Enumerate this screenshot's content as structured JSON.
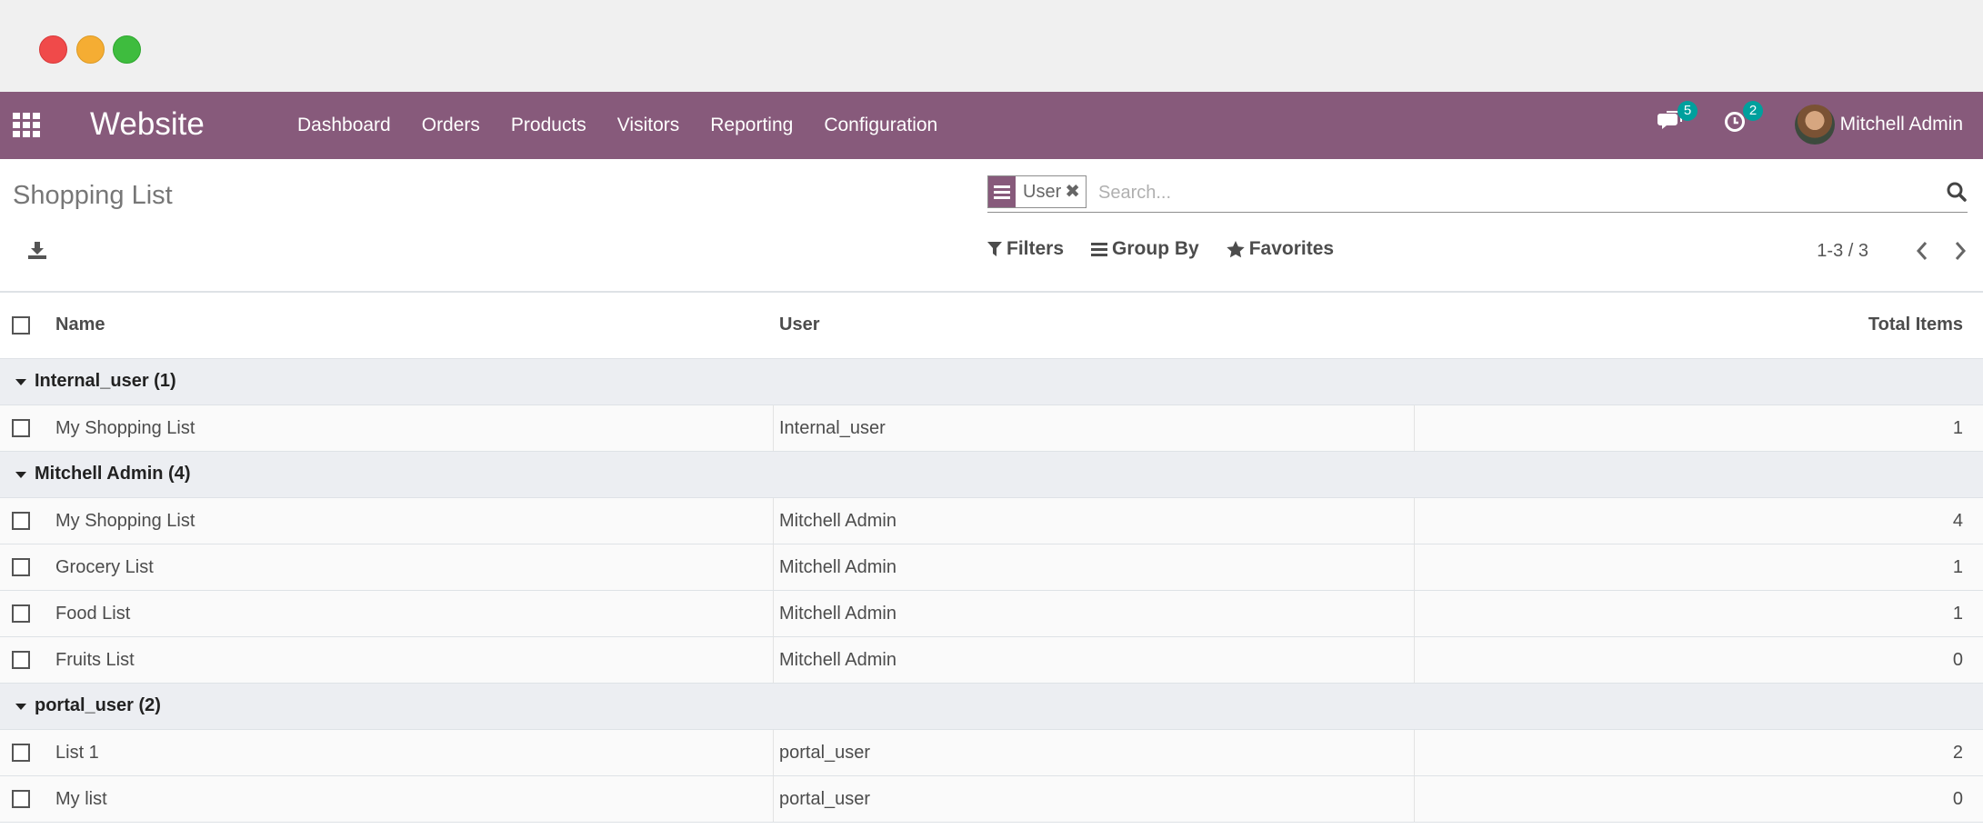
{
  "navbar": {
    "brand": "Website",
    "menu": [
      "Dashboard",
      "Orders",
      "Products",
      "Visitors",
      "Reporting",
      "Configuration"
    ],
    "messages_count": "5",
    "activities_count": "2",
    "user_name": "Mitchell Admin"
  },
  "control_panel": {
    "title": "Shopping List",
    "facet_label": "User",
    "search_placeholder": "Search...",
    "filters_label": "Filters",
    "group_by_label": "Group By",
    "favorites_label": "Favorites",
    "pager": "1-3 / 3"
  },
  "list": {
    "columns": {
      "name": "Name",
      "user": "User",
      "total": "Total Items"
    },
    "groups": [
      {
        "label": "Internal_user (1)",
        "rows": [
          {
            "name": "My Shopping List",
            "user": "Internal_user",
            "total": "1"
          }
        ]
      },
      {
        "label": "Mitchell Admin (4)",
        "rows": [
          {
            "name": "My Shopping List",
            "user": "Mitchell Admin",
            "total": "4"
          },
          {
            "name": "Grocery List",
            "user": "Mitchell Admin",
            "total": "1"
          },
          {
            "name": "Food List",
            "user": "Mitchell Admin",
            "total": "1"
          },
          {
            "name": "Fruits List",
            "user": "Mitchell Admin",
            "total": "0"
          }
        ]
      },
      {
        "label": "portal_user (2)",
        "rows": [
          {
            "name": "List 1",
            "user": "portal_user",
            "total": "2"
          },
          {
            "name": "My list",
            "user": "portal_user",
            "total": "0"
          }
        ]
      }
    ]
  },
  "colors": {
    "brand": "#875a7b",
    "badge": "#00a09d",
    "group_bg": "#eceef2"
  }
}
